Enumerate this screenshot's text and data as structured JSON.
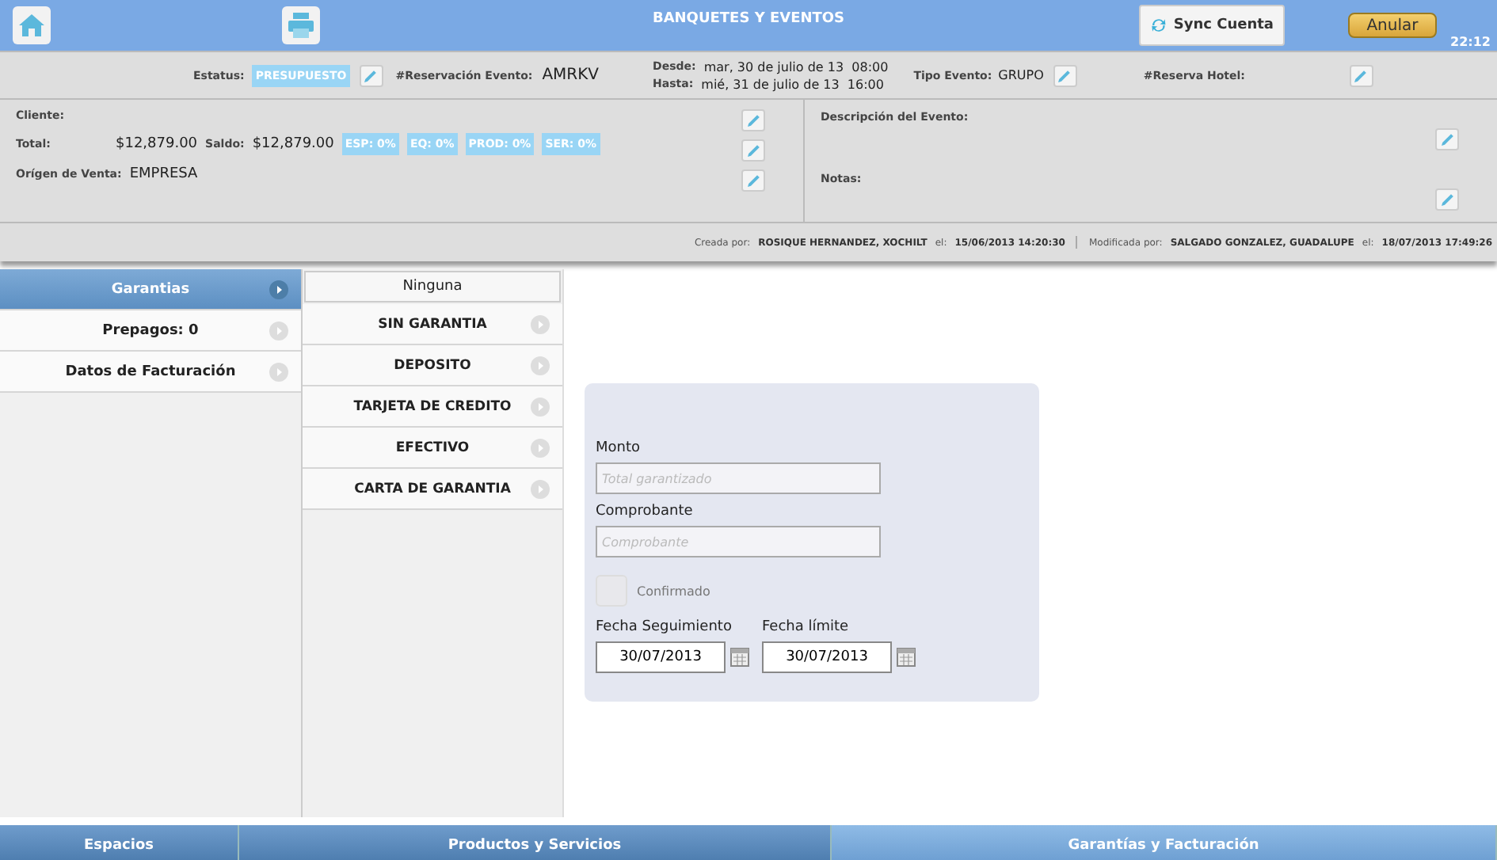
{
  "header": {
    "title": "BANQUETES Y EVENTOS",
    "sync_button": "Sync Cuenta",
    "cancel_button": "Anular",
    "time": "22:12"
  },
  "info": {
    "status_label": "Estatus:",
    "status": "PRESUPUESTO",
    "reservation_label": "#Reservación Evento:",
    "reservation": "AMRKV",
    "from_label": "Desde:",
    "from": "mar, 30 de julio de 13  08:00",
    "to_label": "Hasta:",
    "to": "mié, 31 de julio de 13  16:00",
    "type_label": "Tipo Evento:",
    "type": "GRUPO",
    "hotel_label": "#Reserva Hotel:"
  },
  "details": {
    "client_label": "Cliente:",
    "total_label": "Total:",
    "total": "$12,879.00",
    "balance_label": "Saldo:",
    "balance": "$12,879.00",
    "badges": [
      "ESP: 0%",
      "EQ: 0%",
      "PROD: 0%",
      "SER: 0%"
    ],
    "origin_label": "Orígen de Venta:",
    "origin": "EMPRESA",
    "description_label": "Descripción del Evento:",
    "notes_label": "Notas:"
  },
  "audit": {
    "created_label": "Creada por:",
    "created_by": "ROSIQUE HERNANDEZ, XOCHILT",
    "created_on_label": "el:",
    "created_on": "15/06/2013 14:20:30",
    "modified_label": "Modificada por:",
    "modified_by": "SALGADO GONZALEZ, GUADALUPE",
    "modified_on_label": "el:",
    "modified_on": "18/07/2013 17:49:26"
  },
  "sidebar": {
    "items": [
      {
        "label": "Garantias",
        "selected": true
      },
      {
        "label": "Prepagos: 0",
        "selected": false
      },
      {
        "label": "Datos de Facturación",
        "selected": false
      }
    ]
  },
  "guarantee_types": {
    "header": "Ninguna",
    "items": [
      "SIN GARANTIA",
      "DEPOSITO",
      "TARJETA DE CREDITO",
      "EFECTIVO",
      "CARTA DE GARANTIA"
    ]
  },
  "form": {
    "amount_label": "Monto",
    "amount_placeholder": "Total garantizado",
    "voucher_label": "Comprobante",
    "voucher_placeholder": "Comprobante",
    "confirmed_label": "Confirmado",
    "confirmed": false,
    "followup_label": "Fecha Seguimiento",
    "followup": "30/07/2013",
    "deadline_label": "Fecha límite",
    "deadline": "30/07/2013"
  },
  "bottom_tabs": [
    {
      "label": "Espacios",
      "selected": false
    },
    {
      "label": "Productos y Servicios",
      "selected": false
    },
    {
      "label": "Garantías y Facturación",
      "selected": true
    }
  ]
}
